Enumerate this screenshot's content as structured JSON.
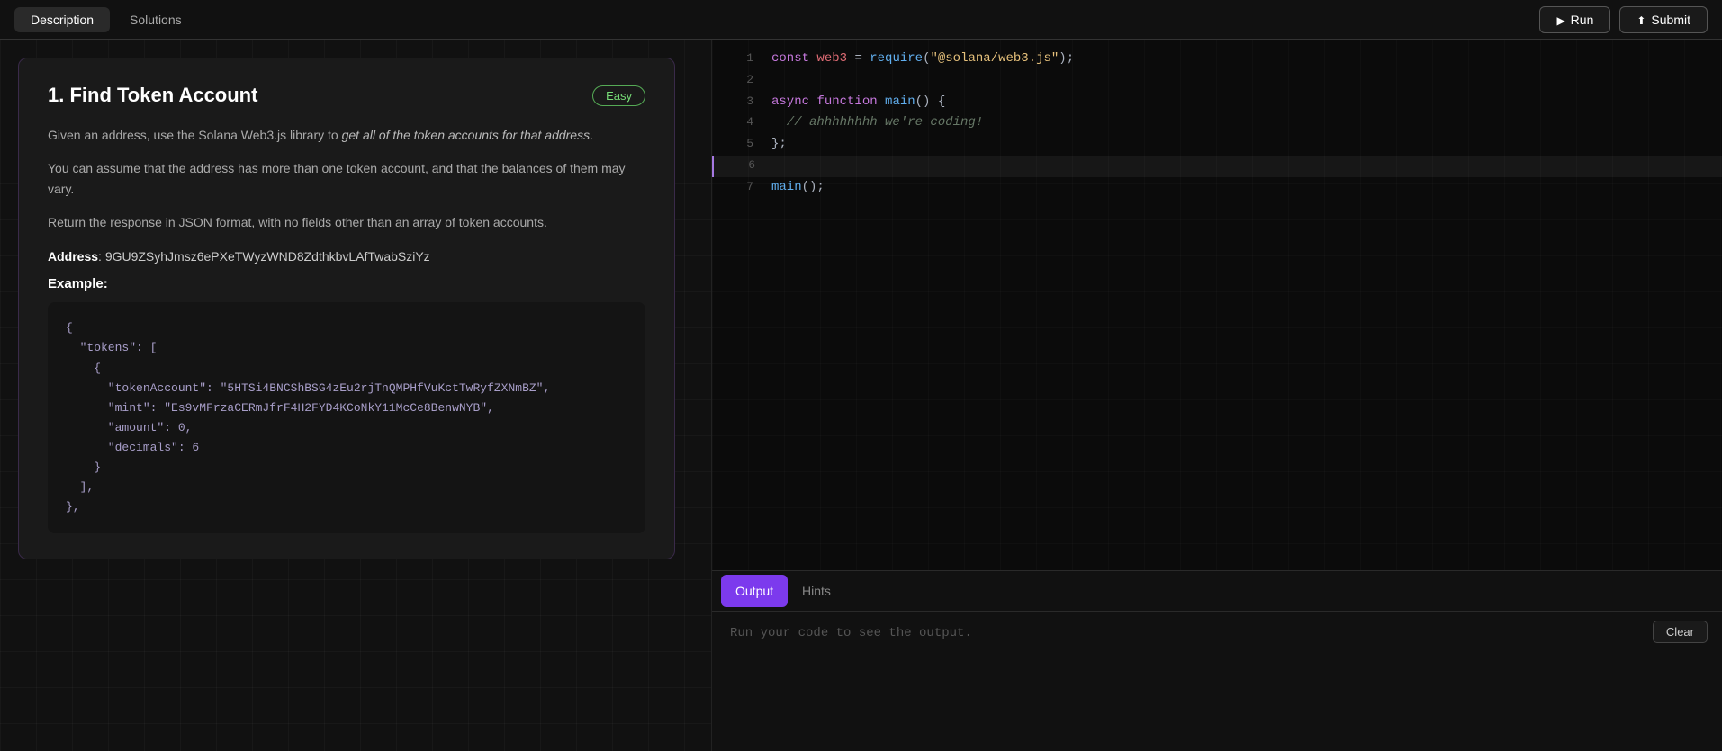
{
  "topbar": {
    "tabs": [
      {
        "id": "description",
        "label": "Description",
        "active": true
      },
      {
        "id": "solutions",
        "label": "Solutions",
        "active": false
      }
    ],
    "run_label": "Run",
    "submit_label": "Submit"
  },
  "problem": {
    "title": "1. Find Token Account",
    "difficulty": "Easy",
    "description_1": "Given an address, use the Solana Web3.js library to ",
    "description_1_em": "get all of the token accounts for that address",
    "description_1_end": ".",
    "description_2": "You can assume that the address has more than one token account, and that the balances of them may vary.",
    "description_3": "Return the response in JSON format, with no fields other than an array of token accounts.",
    "address_label": "Address",
    "address_value": "9GU9ZSyhJmsz6ePXeTWyzWND8ZdthkbvLAfTwabSziYz",
    "example_label": "Example:",
    "example_code": "{\n  \"tokens\": [\n    {\n      \"tokenAccount\": \"5HTSi4BNCShBSG4zEu2rjTnQMPHfVuKctTwRyfZXNmBZ\",\n      \"mint\": \"Es9vMFrzaCERmJfrF4H2FYD4KCoNkY11McCe8BenwNYB\",\n      \"amount\": 0,\n      \"decimals\": 6\n    }\n  ],\n},"
  },
  "editor": {
    "lines": [
      {
        "num": 1,
        "content": "const web3 = require(\"@solana/web3.js\");"
      },
      {
        "num": 2,
        "content": ""
      },
      {
        "num": 3,
        "content": "async function main() {"
      },
      {
        "num": 4,
        "content": "  // ahhhhhhhh we're coding!"
      },
      {
        "num": 5,
        "content": "};"
      },
      {
        "num": 6,
        "content": ""
      },
      {
        "num": 7,
        "content": "main();"
      }
    ]
  },
  "output": {
    "tabs": [
      {
        "id": "output",
        "label": "Output",
        "active": true
      },
      {
        "id": "hints",
        "label": "Hints",
        "active": false
      }
    ],
    "placeholder": "Run your code to see the output.",
    "clear_label": "Clear"
  }
}
